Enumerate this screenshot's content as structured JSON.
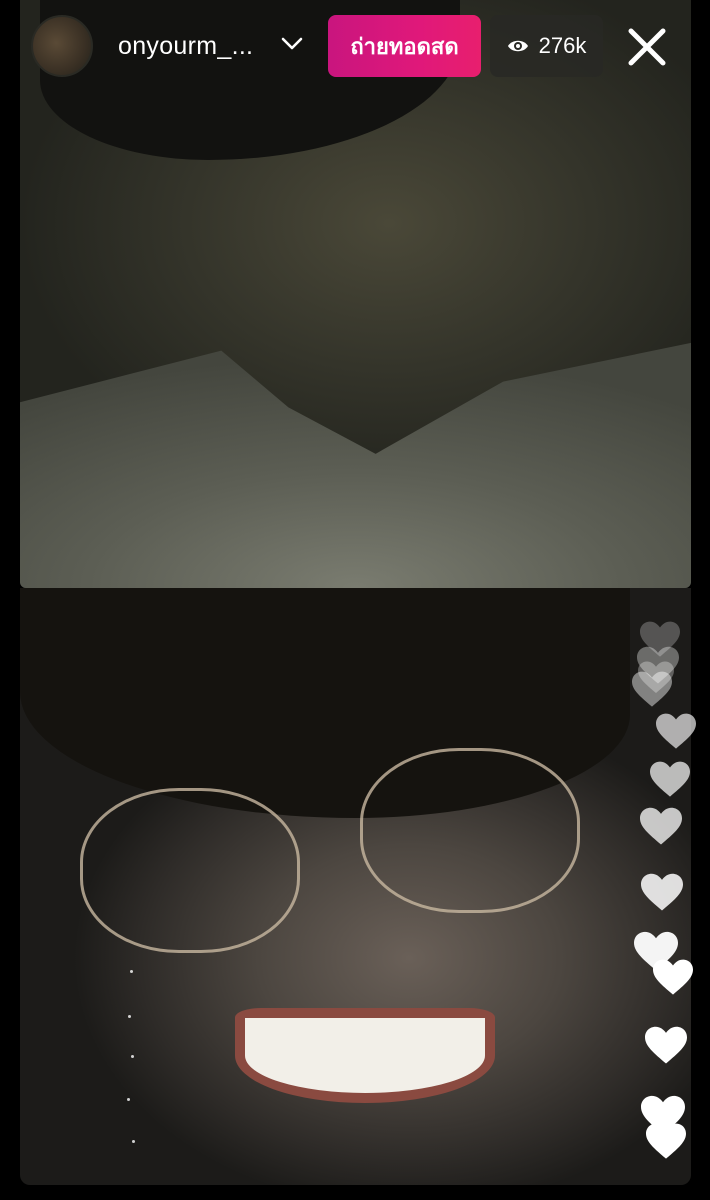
{
  "header": {
    "avatar_icon": "profile-avatar",
    "username": "onyourm_...",
    "dropdown_icon": "chevron-down-icon",
    "live_label": "ถ่ายทอดสด",
    "live_color": "#d4167a",
    "viewer_icon": "eye-icon",
    "viewer_count": "276k",
    "close_icon": "close-icon"
  },
  "streams": [
    {
      "name": "top-video-feed"
    },
    {
      "name": "bottom-video-feed"
    }
  ],
  "reactions": {
    "icon": "heart-icon",
    "count": 13,
    "color": "#ffffff"
  }
}
